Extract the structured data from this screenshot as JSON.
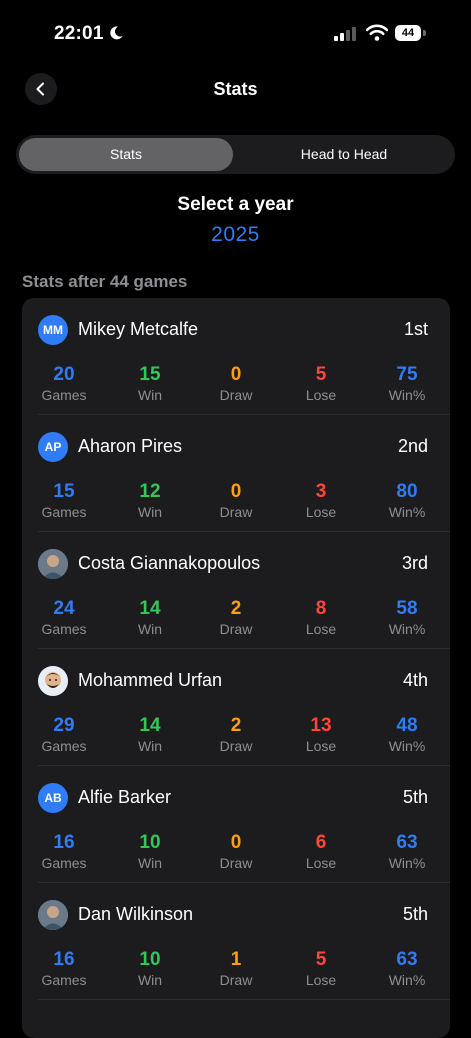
{
  "status_bar": {
    "time": "22:01",
    "battery": "44"
  },
  "nav": {
    "title": "Stats"
  },
  "segments": {
    "stats": "Stats",
    "head_to_head": "Head to Head",
    "selected": "Stats"
  },
  "year_picker": {
    "title": "Select a year",
    "year": "2025"
  },
  "section_title": "Stats after 44 games",
  "labels": {
    "games": "Games",
    "win": "Win",
    "draw": "Draw",
    "lose": "Lose",
    "win_pct": "Win%"
  },
  "colors": {
    "accent": "#2f7cf6",
    "win": "#33c759",
    "draw": "#ff9f0a",
    "lose": "#ff453a"
  },
  "players": [
    {
      "initials": "MM",
      "name": "Mikey Metcalfe",
      "rank": "1st",
      "games": "20",
      "win": "15",
      "draw": "0",
      "lose": "5",
      "win_pct": "75",
      "avatar": "initials"
    },
    {
      "initials": "AP",
      "name": "Aharon Pires",
      "rank": "2nd",
      "games": "15",
      "win": "12",
      "draw": "0",
      "lose": "3",
      "win_pct": "80",
      "avatar": "initials"
    },
    {
      "initials": "",
      "name": "Costa Giannakopoulos",
      "rank": "3rd",
      "games": "24",
      "win": "14",
      "draw": "2",
      "lose": "8",
      "win_pct": "58",
      "avatar": "photo-icon"
    },
    {
      "initials": "",
      "name": "Mohammed Urfan",
      "rank": "4th",
      "games": "29",
      "win": "14",
      "draw": "2",
      "lose": "13",
      "win_pct": "48",
      "avatar": "memoji-icon"
    },
    {
      "initials": "AB",
      "name": "Alfie Barker",
      "rank": "5th",
      "games": "16",
      "win": "10",
      "draw": "0",
      "lose": "6",
      "win_pct": "63",
      "avatar": "initials"
    },
    {
      "initials": "",
      "name": "Dan Wilkinson",
      "rank": "5th",
      "games": "16",
      "win": "10",
      "draw": "1",
      "lose": "5",
      "win_pct": "63",
      "avatar": "photo-icon"
    }
  ]
}
